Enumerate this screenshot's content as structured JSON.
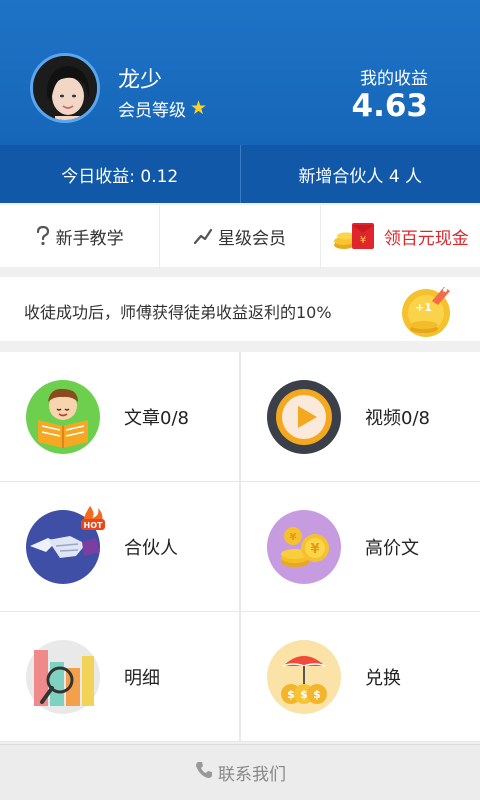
{
  "user": {
    "name": "龙少",
    "member_level": "会员等级"
  },
  "earnings": {
    "label": "我的收益",
    "value": "4.63"
  },
  "stats": {
    "today": "今日收益: 0.12",
    "new_partners": "新增合伙人 4 人"
  },
  "quick_links": [
    {
      "label": "新手教学",
      "icon": "question-icon"
    },
    {
      "label": "星级会员",
      "icon": "trend-icon"
    },
    {
      "label": "领百元现金",
      "icon": "red-envelope-icon"
    }
  ],
  "banner": {
    "text": "收徒成功后，师傅获得徒弟收益返利的10%"
  },
  "tiles": [
    {
      "label": "文章0/8",
      "icon": "reading-boy-icon"
    },
    {
      "label": "视频0/8",
      "icon": "play-icon"
    },
    {
      "label": "合伙人",
      "icon": "handshake-icon",
      "badge": "HOT"
    },
    {
      "label": "高价文",
      "icon": "coins-icon"
    },
    {
      "label": "明细",
      "icon": "chart-icon"
    },
    {
      "label": "兑换",
      "icon": "money-bag-icon"
    }
  ],
  "footer": {
    "contact": "联系我们"
  },
  "colors": {
    "header": "#1e73c6",
    "stats_bar": "#1258a8",
    "red": "#e0252b",
    "star": "#ffd21f"
  }
}
